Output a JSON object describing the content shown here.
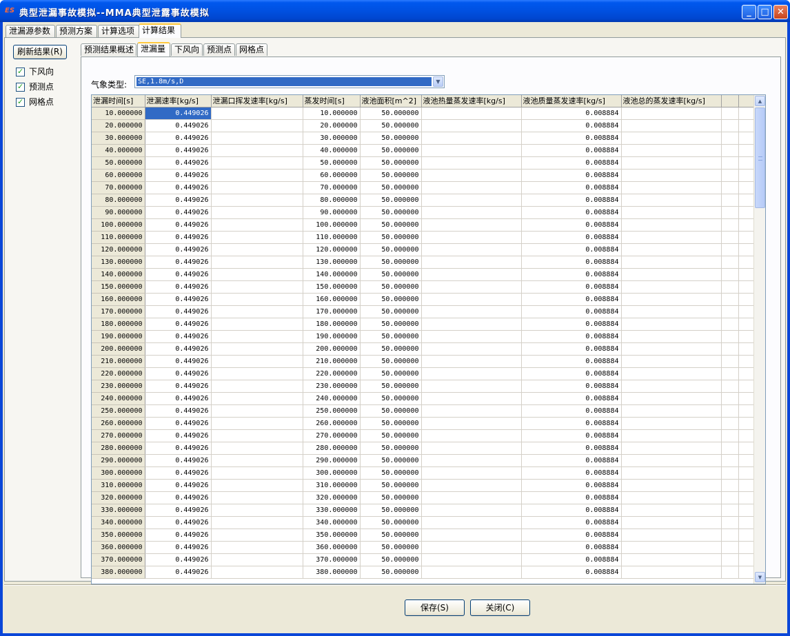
{
  "window": {
    "title": "典型泄漏事故模拟--MMA典型泄露事故模拟",
    "icon_text": "ES"
  },
  "main_tabs": [
    {
      "label": "泄漏源参数"
    },
    {
      "label": "预测方案"
    },
    {
      "label": "计算选项"
    },
    {
      "label": "计算结果"
    }
  ],
  "sidebar": {
    "refresh_label": "刷新结果(R)",
    "checks": [
      {
        "label": "下风向",
        "checked": true
      },
      {
        "label": "预测点",
        "checked": true
      },
      {
        "label": "网格点",
        "checked": true
      }
    ]
  },
  "result_tabs": [
    {
      "label": "预测结果概述"
    },
    {
      "label": "泄漏量"
    },
    {
      "label": "下风向"
    },
    {
      "label": "预测点"
    },
    {
      "label": "网格点"
    }
  ],
  "weather": {
    "label": "气象类型:",
    "value": "SE,1.8m/s,D"
  },
  "table": {
    "columns": [
      "泄漏时间[s]",
      "泄漏速率[kg/s]",
      "泄漏口挥发速率[kg/s]",
      "蒸发时间[s]",
      "液池面积[m^2]",
      "液池热量蒸发速率[kg/s]",
      "液池质量蒸发速率[kg/s]",
      "液池总的蒸发速率[kg/s]"
    ],
    "rows": [
      [
        "10.000000",
        "0.449026",
        "",
        "10.000000",
        "50.000000",
        "",
        "0.008884",
        ""
      ],
      [
        "20.000000",
        "0.449026",
        "",
        "20.000000",
        "50.000000",
        "",
        "0.008884",
        ""
      ],
      [
        "30.000000",
        "0.449026",
        "",
        "30.000000",
        "50.000000",
        "",
        "0.008884",
        ""
      ],
      [
        "40.000000",
        "0.449026",
        "",
        "40.000000",
        "50.000000",
        "",
        "0.008884",
        ""
      ],
      [
        "50.000000",
        "0.449026",
        "",
        "50.000000",
        "50.000000",
        "",
        "0.008884",
        ""
      ],
      [
        "60.000000",
        "0.449026",
        "",
        "60.000000",
        "50.000000",
        "",
        "0.008884",
        ""
      ],
      [
        "70.000000",
        "0.449026",
        "",
        "70.000000",
        "50.000000",
        "",
        "0.008884",
        ""
      ],
      [
        "80.000000",
        "0.449026",
        "",
        "80.000000",
        "50.000000",
        "",
        "0.008884",
        ""
      ],
      [
        "90.000000",
        "0.449026",
        "",
        "90.000000",
        "50.000000",
        "",
        "0.008884",
        ""
      ],
      [
        "100.000000",
        "0.449026",
        "",
        "100.000000",
        "50.000000",
        "",
        "0.008884",
        ""
      ],
      [
        "110.000000",
        "0.449026",
        "",
        "110.000000",
        "50.000000",
        "",
        "0.008884",
        ""
      ],
      [
        "120.000000",
        "0.449026",
        "",
        "120.000000",
        "50.000000",
        "",
        "0.008884",
        ""
      ],
      [
        "130.000000",
        "0.449026",
        "",
        "130.000000",
        "50.000000",
        "",
        "0.008884",
        ""
      ],
      [
        "140.000000",
        "0.449026",
        "",
        "140.000000",
        "50.000000",
        "",
        "0.008884",
        ""
      ],
      [
        "150.000000",
        "0.449026",
        "",
        "150.000000",
        "50.000000",
        "",
        "0.008884",
        ""
      ],
      [
        "160.000000",
        "0.449026",
        "",
        "160.000000",
        "50.000000",
        "",
        "0.008884",
        ""
      ],
      [
        "170.000000",
        "0.449026",
        "",
        "170.000000",
        "50.000000",
        "",
        "0.008884",
        ""
      ],
      [
        "180.000000",
        "0.449026",
        "",
        "180.000000",
        "50.000000",
        "",
        "0.008884",
        ""
      ],
      [
        "190.000000",
        "0.449026",
        "",
        "190.000000",
        "50.000000",
        "",
        "0.008884",
        ""
      ],
      [
        "200.000000",
        "0.449026",
        "",
        "200.000000",
        "50.000000",
        "",
        "0.008884",
        ""
      ],
      [
        "210.000000",
        "0.449026",
        "",
        "210.000000",
        "50.000000",
        "",
        "0.008884",
        ""
      ],
      [
        "220.000000",
        "0.449026",
        "",
        "220.000000",
        "50.000000",
        "",
        "0.008884",
        ""
      ],
      [
        "230.000000",
        "0.449026",
        "",
        "230.000000",
        "50.000000",
        "",
        "0.008884",
        ""
      ],
      [
        "240.000000",
        "0.449026",
        "",
        "240.000000",
        "50.000000",
        "",
        "0.008884",
        ""
      ],
      [
        "250.000000",
        "0.449026",
        "",
        "250.000000",
        "50.000000",
        "",
        "0.008884",
        ""
      ],
      [
        "260.000000",
        "0.449026",
        "",
        "260.000000",
        "50.000000",
        "",
        "0.008884",
        ""
      ],
      [
        "270.000000",
        "0.449026",
        "",
        "270.000000",
        "50.000000",
        "",
        "0.008884",
        ""
      ],
      [
        "280.000000",
        "0.449026",
        "",
        "280.000000",
        "50.000000",
        "",
        "0.008884",
        ""
      ],
      [
        "290.000000",
        "0.449026",
        "",
        "290.000000",
        "50.000000",
        "",
        "0.008884",
        ""
      ],
      [
        "300.000000",
        "0.449026",
        "",
        "300.000000",
        "50.000000",
        "",
        "0.008884",
        ""
      ],
      [
        "310.000000",
        "0.449026",
        "",
        "310.000000",
        "50.000000",
        "",
        "0.008884",
        ""
      ],
      [
        "320.000000",
        "0.449026",
        "",
        "320.000000",
        "50.000000",
        "",
        "0.008884",
        ""
      ],
      [
        "330.000000",
        "0.449026",
        "",
        "330.000000",
        "50.000000",
        "",
        "0.008884",
        ""
      ],
      [
        "340.000000",
        "0.449026",
        "",
        "340.000000",
        "50.000000",
        "",
        "0.008884",
        ""
      ],
      [
        "350.000000",
        "0.449026",
        "",
        "350.000000",
        "50.000000",
        "",
        "0.008884",
        ""
      ],
      [
        "360.000000",
        "0.449026",
        "",
        "360.000000",
        "50.000000",
        "",
        "0.008884",
        ""
      ],
      [
        "370.000000",
        "0.449026",
        "",
        "370.000000",
        "50.000000",
        "",
        "0.008884",
        ""
      ],
      [
        "380.000000",
        "0.449026",
        "",
        "380.000000",
        "50.000000",
        "",
        "0.008884",
        ""
      ]
    ]
  },
  "footer": {
    "save_label": "保存(S)",
    "close_label": "关闭(C)"
  },
  "colors": {
    "titlebar": "#0058ee",
    "selection": "#316ac5",
    "dialog_bg": "#ece9d8"
  }
}
